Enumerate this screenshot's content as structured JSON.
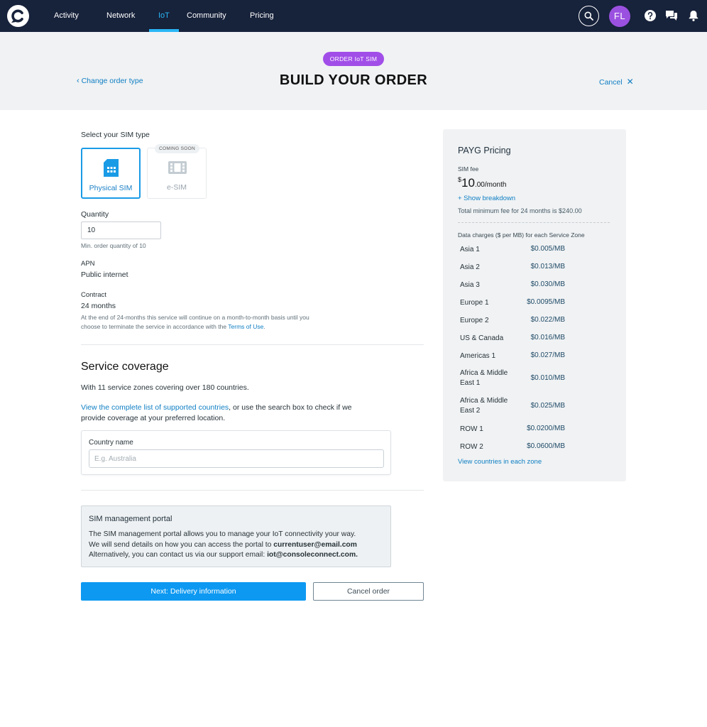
{
  "nav": {
    "logo_icon": "console-connect-logo-icon",
    "items": [
      {
        "label": "Activity",
        "active": false
      },
      {
        "label": "Network",
        "active": false
      },
      {
        "label": "IoT",
        "active": true
      },
      {
        "label": "Community",
        "active": false
      },
      {
        "label": "Pricing",
        "active": false
      }
    ],
    "avatar_initials": "FL",
    "icons": [
      "search-icon",
      "help-icon",
      "chat-icon",
      "bell-icon"
    ],
    "accent_color": "#29b6f6"
  },
  "header": {
    "pill": "ORDER IoT SIM",
    "title": "BUILD YOUR ORDER",
    "back_link": "Change order type",
    "cancel_link": "Cancel"
  },
  "sim_type": {
    "heading": "Select your SIM type",
    "options": [
      {
        "label": "Physical SIM",
        "selected": true,
        "icon": "sim-card-icon"
      },
      {
        "label": "e-SIM",
        "selected": false,
        "badge": "COMING SOON",
        "icon": "esim-icon"
      }
    ]
  },
  "quantity": {
    "label": "Quantity",
    "value": "10",
    "hint": "Min. order quantity of 10"
  },
  "apn": {
    "label": "APN",
    "value": "Public internet"
  },
  "contract": {
    "label": "Contract",
    "value": "24 months",
    "note_line1": "At the end of 24-months this service will continue on a month-to-month basis until you",
    "note_line2_prefix": "choose to terminate the service in accordance with the ",
    "note_link": "Terms of Use",
    "note_suffix": "."
  },
  "coverage": {
    "heading": "Service coverage",
    "summary": "With 11 service zones covering over 180 countries.",
    "link": "View the complete list of supported countries",
    "text_line1_suffix": ", or use the search box to check if we",
    "text_line2": "provide coverage at your preferred location.",
    "country_label": "Country name",
    "country_placeholder": "E.g. Australia",
    "country_value": ""
  },
  "portal": {
    "title": "SIM management portal",
    "line1": "The SIM management portal allows you to manage your IoT connectivity your way.",
    "line2_prefix": "We will send details on how you can access the portal to ",
    "line2_email": "currentuser@email.com",
    "line3_prefix": "Alternatively, you can contact us via our support email: ",
    "line3_email": "iot@consoleconnect.com."
  },
  "actions": {
    "next": "Next: Delivery information",
    "cancel": "Cancel order"
  },
  "pricing": {
    "title": "PAYG Pricing",
    "sim_fee_label": "SIM fee",
    "currency": "$",
    "fee_major": "10",
    "fee_minor": ".00/month",
    "show_breakdown": "+ Show breakdown",
    "total_min": "Total minimum fee for 24 months is $240.00",
    "data_heading": "Data charges ($ per MB) for each Service Zone",
    "zones": [
      {
        "name": "Asia 1",
        "price": "$0.005/MB"
      },
      {
        "name": "Asia 2",
        "price": "$0.013/MB"
      },
      {
        "name": "Asia 3",
        "price": "$0.030/MB"
      },
      {
        "name": "Europe 1",
        "price": "$0.0095/MB"
      },
      {
        "name": "Europe 2",
        "price": "$0.022/MB"
      },
      {
        "name": "US & Canada",
        "price": "$0.016/MB"
      },
      {
        "name": "Americas 1",
        "price": "$0.027/MB"
      },
      {
        "name": "Africa & Middle East 1",
        "price": "$0.010/MB"
      },
      {
        "name": "Africa & Middle East 2",
        "price": "$0.025/MB"
      },
      {
        "name": "ROW 1",
        "price": "$0.0200/MB"
      },
      {
        "name": "ROW 2",
        "price": "$0.0600/MB"
      }
    ],
    "countries_link": "View countries in each zone"
  }
}
